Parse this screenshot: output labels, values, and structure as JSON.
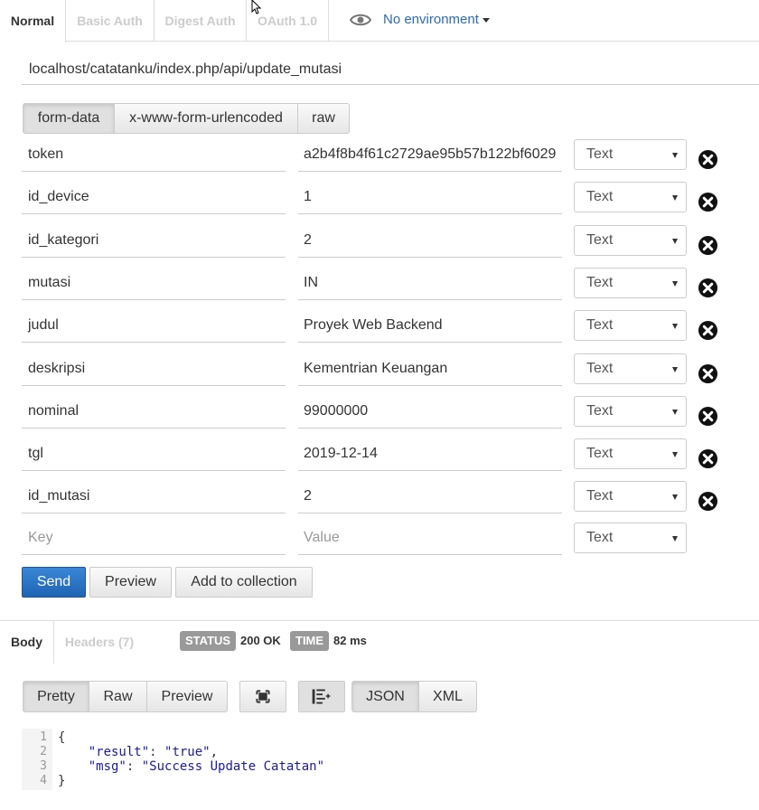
{
  "auth_tabs": [
    "Normal",
    "Basic Auth",
    "Digest Auth",
    "OAuth 1.0"
  ],
  "environment": {
    "label": "No environment",
    "icon": "eye-icon"
  },
  "url": "localhost/catatanku/index.php/api/update_mutasi",
  "body_types": [
    "form-data",
    "x-www-form-urlencoded",
    "raw"
  ],
  "params": [
    {
      "key": "token",
      "value": "a2b4f8b4f61c2729ae95b57b122bf6029",
      "type": "Text"
    },
    {
      "key": "id_device",
      "value": "1",
      "type": "Text"
    },
    {
      "key": "id_kategori",
      "value": "2",
      "type": "Text"
    },
    {
      "key": "mutasi",
      "value": "IN",
      "type": "Text"
    },
    {
      "key": "judul",
      "value": "Proyek Web Backend",
      "type": "Text"
    },
    {
      "key": "deskripsi",
      "value": "Kementrian Keuangan",
      "type": "Text"
    },
    {
      "key": "nominal",
      "value": "99000000",
      "type": "Text"
    },
    {
      "key": "tgl",
      "value": "2019-12-14",
      "type": "Text"
    },
    {
      "key": "id_mutasi",
      "value": "2",
      "type": "Text"
    }
  ],
  "new_param": {
    "key_placeholder": "Key",
    "value_placeholder": "Value",
    "type": "Text"
  },
  "actions": {
    "send": "Send",
    "preview": "Preview",
    "add_to_collection": "Add to collection"
  },
  "response": {
    "tabs": [
      "Body",
      "Headers (7)"
    ],
    "status_label": "STATUS",
    "status_value": "200 OK",
    "time_label": "TIME",
    "time_value": "82 ms",
    "view_modes": [
      "Pretty",
      "Raw",
      "Preview"
    ],
    "formats": [
      "JSON",
      "XML"
    ],
    "line_numbers": [
      "1",
      "2",
      "3",
      "4"
    ],
    "code": {
      "open": "{",
      "key1": "\"result\"",
      "val1": "\"true\"",
      "key2": "\"msg\"",
      "val2": "\"Success Update Catatan\"",
      "close": "}"
    }
  },
  "colors": {
    "send": "#2466b8",
    "link": "#2a6db5",
    "json_string": "#1a1aa6"
  }
}
